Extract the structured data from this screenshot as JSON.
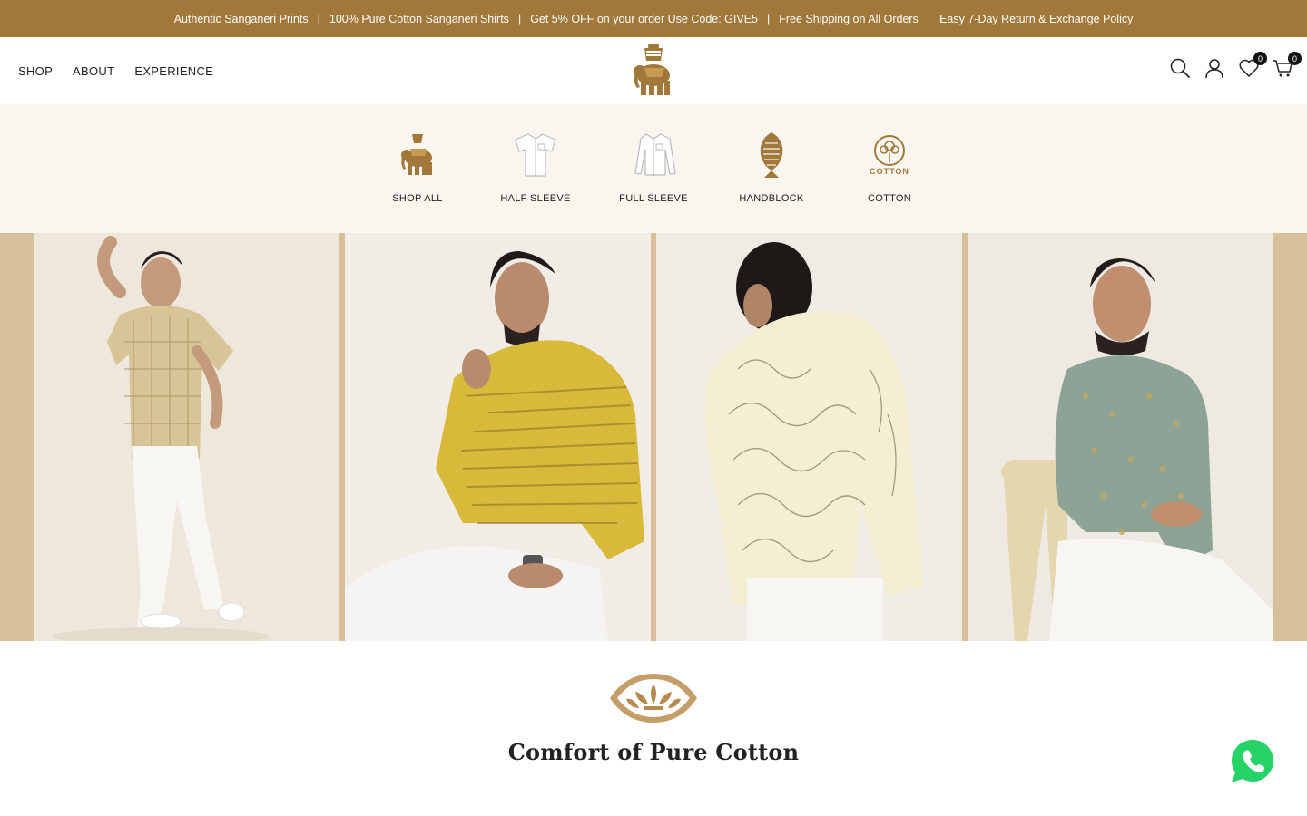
{
  "announcement": {
    "items": [
      "Authentic Sanganeri Prints",
      "100% Pure Cotton Sanganeri Shirts",
      "Get 5% OFF on your order Use Code: GIVE5",
      "Free Shipping on All Orders",
      "Easy 7-Day Return & Exchange Policy"
    ],
    "separator": "|"
  },
  "nav": {
    "shop": "SHOP",
    "about": "ABOUT",
    "experience": "EXPERIENCE"
  },
  "header_icons": {
    "search": "search-icon",
    "account": "user-icon",
    "wishlist": "heart-icon",
    "cart": "cart-icon",
    "wishlist_count": "0",
    "cart_count": "0"
  },
  "categories": [
    {
      "label": "SHOP ALL",
      "icon": "elephant-icon"
    },
    {
      "label": "HALF SLEEVE",
      "icon": "half-sleeve-shirt-icon"
    },
    {
      "label": "FULL SLEEVE",
      "icon": "full-sleeve-shirt-icon"
    },
    {
      "label": "HANDBLOCK",
      "icon": "paisley-block-icon"
    },
    {
      "label": "COTTON",
      "icon": "cotton-icon",
      "icon_text": "COTTON"
    }
  ],
  "section": {
    "title": "Comfort of Pure Cotton"
  },
  "colors": {
    "brand": "#a2783a",
    "cream": "#f9f6ef",
    "accent_tan": "#d8bf9a",
    "whatsapp": "#25d366"
  }
}
